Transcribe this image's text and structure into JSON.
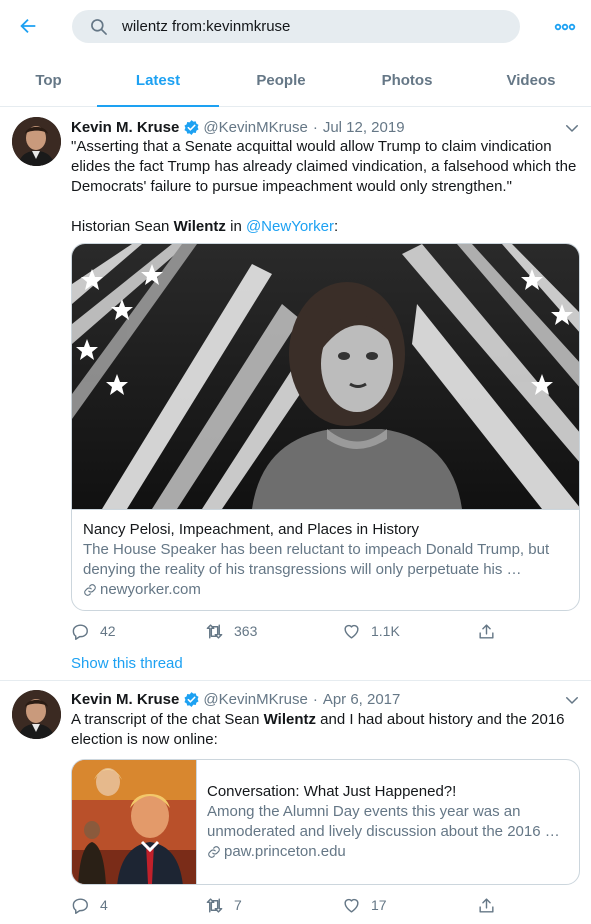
{
  "search": {
    "query": "wilentz from:kevinmkruse"
  },
  "tabs": [
    {
      "label": "Top"
    },
    {
      "label": "Latest"
    },
    {
      "label": "People"
    },
    {
      "label": "Photos"
    },
    {
      "label": "Videos"
    }
  ],
  "active_tab": "Latest",
  "colors": {
    "accent": "#1da1f2",
    "secondary_text": "#657786",
    "border": "#ccd6dd",
    "search_bg": "#e6ecf0"
  },
  "icons": [
    "back-arrow-icon",
    "search-icon",
    "more-icon",
    "verified-icon",
    "chevron-down-icon",
    "reply-icon",
    "retweet-icon",
    "like-icon",
    "share-icon",
    "link-icon"
  ],
  "tweets": [
    {
      "name": "Kevin M. Kruse",
      "handle": "@KevinMKruse",
      "dot": "·",
      "date": "Jul 12, 2019",
      "text_quote": "\"Asserting that a Senate acquittal would allow Trump to claim vindication elides the fact Trump has already claimed vindication, a falsehood which the Democrats' failure to pursue impeachment would only strengthen.\"",
      "text_pre": "Historian Sean ",
      "text_bold": "Wilentz",
      "text_mid": " in ",
      "text_link": "@NewYorker",
      "text_post": ":",
      "card": {
        "title": "Nancy Pelosi, Impeachment, and Places in History",
        "description": "The House Speaker has been reluctant to impeach Donald Trump, but denying the reality of his transgressions will only perpetuate his …",
        "domain": "newyorker.com"
      },
      "replies": "42",
      "retweets": "363",
      "likes": "1.1K",
      "show_thread": "Show this thread"
    },
    {
      "name": "Kevin M. Kruse",
      "handle": "@KevinMKruse",
      "dot": "·",
      "date": "Apr 6, 2017",
      "text_pre": "A transcript of the chat Sean ",
      "text_bold": "Wilentz",
      "text_post": " and I had about history and the 2016 election is now online:",
      "card": {
        "title": "Conversation: What Just Happened?!",
        "description": "Among the Alumni Day events this year was an unmoderated and lively discussion about the 2016 …",
        "domain": "paw.princeton.edu"
      },
      "replies": "4",
      "retweets": "7",
      "likes": "17"
    }
  ]
}
